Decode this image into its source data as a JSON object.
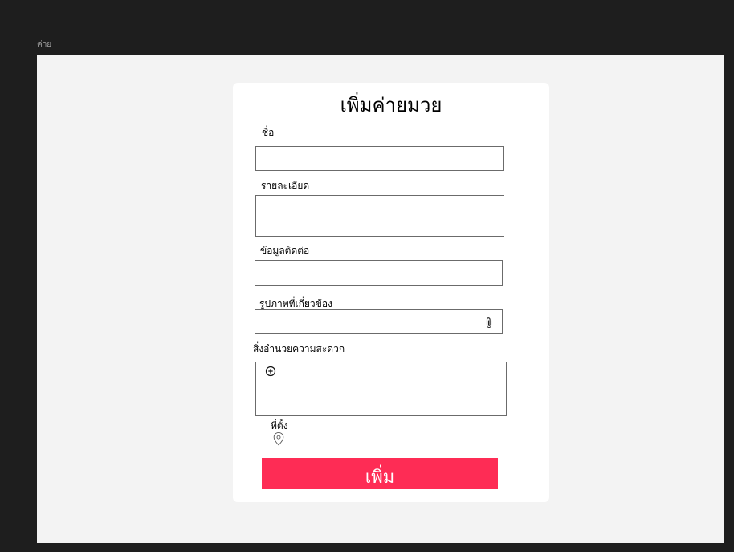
{
  "frame": {
    "label": "ค่าย"
  },
  "form": {
    "title": "เพิ่มค่ายมวย",
    "fields": {
      "name": {
        "label": "ชื่อ",
        "value": "",
        "placeholder": ""
      },
      "details": {
        "label": "รายละเอียด",
        "value": "",
        "placeholder": ""
      },
      "contact": {
        "label": "ข้อมูลติดต่อ",
        "value": "",
        "placeholder": ""
      },
      "images": {
        "label": "รูปภาพที่เกี่ยวข้อง",
        "value": "",
        "placeholder": ""
      },
      "facilities": {
        "label": "สิ่งอำนวยความสะดวก"
      },
      "location": {
        "label": "ที่ตั้ง"
      }
    },
    "submit_label": "เพิ่ม"
  },
  "colors": {
    "background": "#1e1e1e",
    "frame": "#f3f3f3",
    "card": "#ffffff",
    "accent": "#fe2c55",
    "border": "#6b6b6b"
  },
  "icons": {
    "attach": "paperclip-icon",
    "add": "plus-circle-icon",
    "location": "map-pin-icon"
  }
}
